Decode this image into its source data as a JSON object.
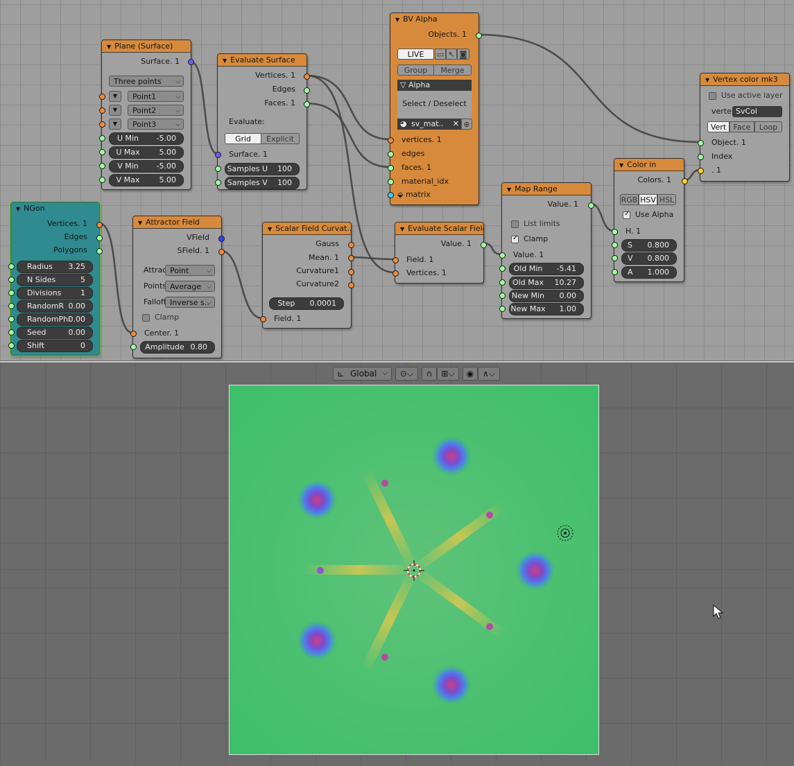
{
  "colors": {
    "node_header": "#d78a3c",
    "node_body": "#a1a1a1",
    "ngon_body": "#2f8b8f",
    "plane_green": "#3dbf6a",
    "blob_magenta": "#c43c8c",
    "blob_blue": "#4a6cff"
  },
  "nodes": {
    "plane": {
      "title": "Plane (Surface)",
      "out_surface": "Surface. 1",
      "mode": "Three points",
      "points": [
        "Point1",
        "Point2",
        "Point3"
      ],
      "params": [
        {
          "label": "U Min",
          "value": "-5.00"
        },
        {
          "label": "U Max",
          "value": "5.00"
        },
        {
          "label": "V Min",
          "value": "-5.00"
        },
        {
          "label": "V Max",
          "value": "5.00"
        }
      ]
    },
    "evaluate_surface": {
      "title": "Evaluate Surface",
      "out_vertices": "Vertices. 1",
      "out_edges": "Edges",
      "out_faces": "Faces. 1",
      "evaluate_label": "Evaluate:",
      "mode_grid": "Grid",
      "mode_explicit": "Explicit",
      "in_surface": "Surface. 1",
      "samples_u": {
        "label": "Samples U",
        "value": "100"
      },
      "samples_v": {
        "label": "Samples V",
        "value": "100"
      }
    },
    "bv_alpha": {
      "title": "BV Alpha",
      "out_objects": "Objects. 1",
      "live": "LIVE",
      "group": "Group",
      "merge": "Merge",
      "alpha": "Alpha",
      "select": "Select / Deselect",
      "material": "sv_mat..",
      "close": "✕",
      "in_vertices": "vertices. 1",
      "in_edges": "edges",
      "in_faces": "faces. 1",
      "in_material": "material_idx",
      "in_matrix": "matrix"
    },
    "vertex_color": {
      "title": "Vertex color mk3",
      "use_active": "Use active layer",
      "vert_label": "verte",
      "vert_value": "SvCol",
      "mode_vert": "Vert",
      "mode_face": "Face",
      "mode_loop": "Loop",
      "in_object": "Object. 1",
      "in_index": "Index",
      "in_color": ". 1"
    },
    "color_in": {
      "title": "Color in",
      "out_colors": "Colors. 1",
      "mode_rgb": "RGB",
      "mode_hsv": "HSV",
      "mode_hsl": "HSL",
      "use_alpha": "Use Alpha",
      "in_h": "H. 1",
      "s": {
        "label": "S",
        "value": "0.800"
      },
      "v": {
        "label": "V",
        "value": "0.800"
      },
      "a": {
        "label": "A",
        "value": "1.000"
      }
    },
    "map_range": {
      "title": "Map Range",
      "out_value": "Value. 1",
      "list_limits": "List limits",
      "clamp": "Clamp",
      "in_value": "Value. 1",
      "params": [
        {
          "label": "Old Min",
          "value": "-5.41"
        },
        {
          "label": "Old Max",
          "value": "10.27"
        },
        {
          "label": "New Min",
          "value": "0.00"
        },
        {
          "label": "New Max",
          "value": "1.00"
        }
      ]
    },
    "ngon": {
      "title": "NGon",
      "out_vertices": "Vertices. 1",
      "out_edges": "Edges",
      "out_polygons": "Polygons",
      "params": [
        {
          "label": "Radius",
          "value": "3.25"
        },
        {
          "label": "N Sides",
          "value": "5"
        },
        {
          "label": "Divisions",
          "value": "1"
        },
        {
          "label": "RandomR",
          "value": "0.00"
        },
        {
          "label": "RandomPhi",
          "value": "0.00"
        },
        {
          "label": "Seed",
          "value": "0.00"
        },
        {
          "label": "Shift",
          "value": "0"
        }
      ]
    },
    "attractor": {
      "title": "Attractor Field",
      "out_vfield": "VField",
      "out_sfield": "SField. 1",
      "attrac_label": "Attrac",
      "attrac_value": "Point",
      "points_label": "Points",
      "points_value": "Average",
      "falloff_label": "Falloff",
      "falloff_value": "Inverse s..",
      "clamp": "Clamp",
      "in_center": "Center. 1",
      "amplitude": {
        "label": "Amplitude",
        "value": "0.80"
      }
    },
    "scalar_curv": {
      "title": "Scalar Field Curvat..",
      "out_gauss": "Gauss",
      "out_mean": "Mean. 1",
      "out_c1": "Curvature1",
      "out_c2": "Curvature2",
      "step": {
        "label": "Step",
        "value": "0.0001"
      },
      "in_field": "Field. 1"
    },
    "eval_scalar": {
      "title": "Evaluate Scalar Field",
      "out_value": "Value. 1",
      "in_field": "Field. 1",
      "in_vertices": "Vertices. 1"
    }
  },
  "viewport": {
    "orientation": "Global"
  }
}
